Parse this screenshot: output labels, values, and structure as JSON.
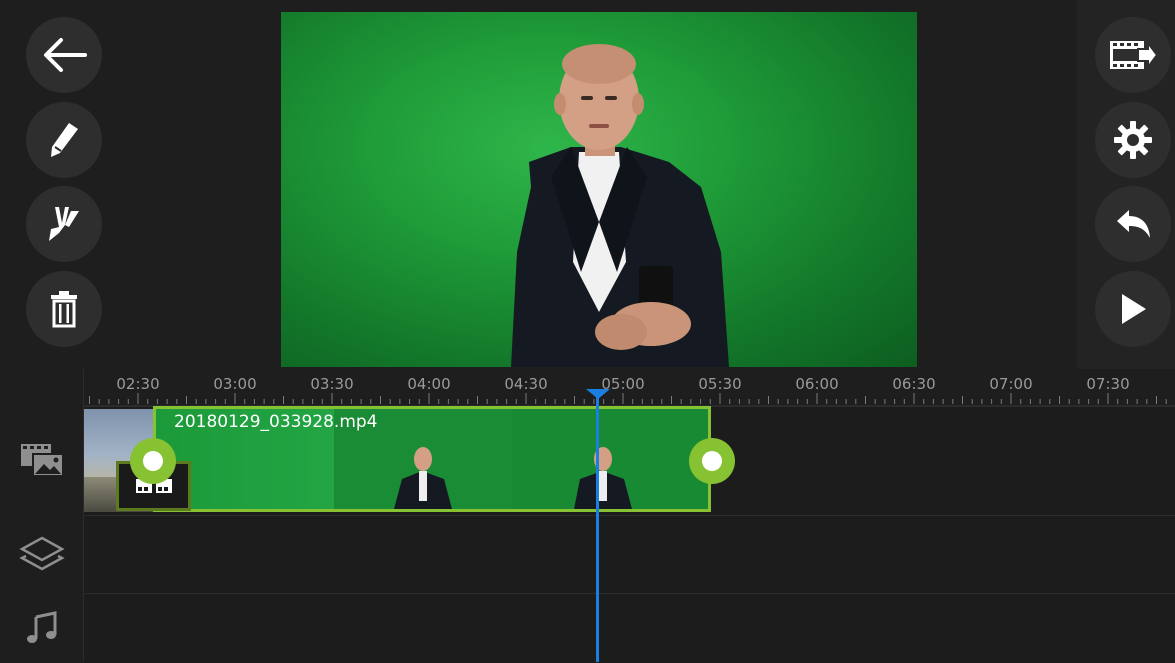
{
  "toolbar_left": {
    "back": {
      "icon": "arrow-left-icon"
    },
    "edit": {
      "icon": "pencil-icon"
    },
    "split": {
      "icon": "split-icon"
    },
    "delete": {
      "icon": "trash-icon"
    }
  },
  "toolbar_right": {
    "export": {
      "icon": "film-export-icon"
    },
    "settings": {
      "icon": "gear-icon"
    },
    "undo": {
      "icon": "undo-icon"
    },
    "play": {
      "icon": "play-icon"
    }
  },
  "timeline": {
    "ruler_labels": [
      "02:30",
      "03:00",
      "03:30",
      "04:00",
      "04:30",
      "05:00",
      "05:30",
      "06:00",
      "06:30",
      "07:00",
      "07:30"
    ],
    "tracks": [
      {
        "icon": "media-track-icon"
      },
      {
        "icon": "layers-icon"
      },
      {
        "icon": "music-note-icon"
      }
    ],
    "selected_clip": {
      "name": "20180129_033928.mp4"
    }
  },
  "colors": {
    "accent_green": "#86c232",
    "playhead_blue": "#1a7fe0",
    "background": "#1e1e1e"
  }
}
